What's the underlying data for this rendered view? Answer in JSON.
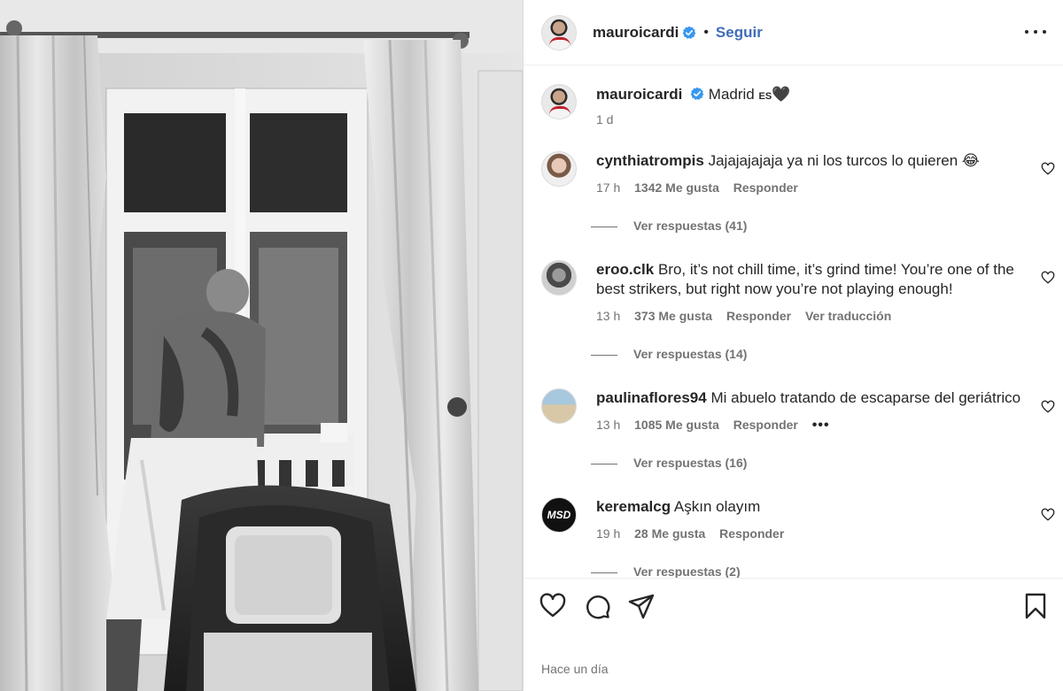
{
  "header": {
    "username": "mauroicardi",
    "separator": "•",
    "follow_label": "Seguir"
  },
  "caption": {
    "username": "mauroicardi",
    "text": "Madrid",
    "flag_text": "ES",
    "emoji": "🖤",
    "time": "1 d"
  },
  "comments": [
    {
      "username": "cynthiatrompis",
      "text": "Jajajajajaja ya ni los turcos lo quieren 😂",
      "time": "17 h",
      "likes": "1342 Me gusta",
      "reply_label": "Responder",
      "replies": "Ver respuestas (41)"
    },
    {
      "username": "eroo.clk",
      "text": "Bro, it’s not chill time, it’s grind time! You’re one of the best strikers, but right now you’re not playing enough!",
      "time": "13 h",
      "likes": "373 Me gusta",
      "reply_label": "Responder",
      "translate_label": "Ver traducción",
      "replies": "Ver respuestas (14)"
    },
    {
      "username": "paulinaflores94",
      "text": "Mi abuelo tratando de escaparse del geriátrico",
      "time": "13 h",
      "likes": "1085 Me gusta",
      "reply_label": "Responder",
      "options": "•••",
      "replies": "Ver respuestas (16)"
    },
    {
      "username": "keremalcg",
      "text": "Aşkın olayım",
      "time": "19 h",
      "likes": "28 Me gusta",
      "reply_label": "Responder",
      "replies": "Ver respuestas (2)",
      "avatar_text": "MSD"
    }
  ],
  "footer": {
    "time": "Hace un día"
  },
  "icons": {
    "like": "heart-icon",
    "comment": "comment-icon",
    "share": "share-icon",
    "save": "bookmark-icon",
    "verified": "verified-badge-icon",
    "more": "more-options-icon"
  },
  "colors": {
    "follow": "#3f6db6",
    "verified": "#3897f0",
    "muted": "#737373",
    "text": "#262626"
  }
}
